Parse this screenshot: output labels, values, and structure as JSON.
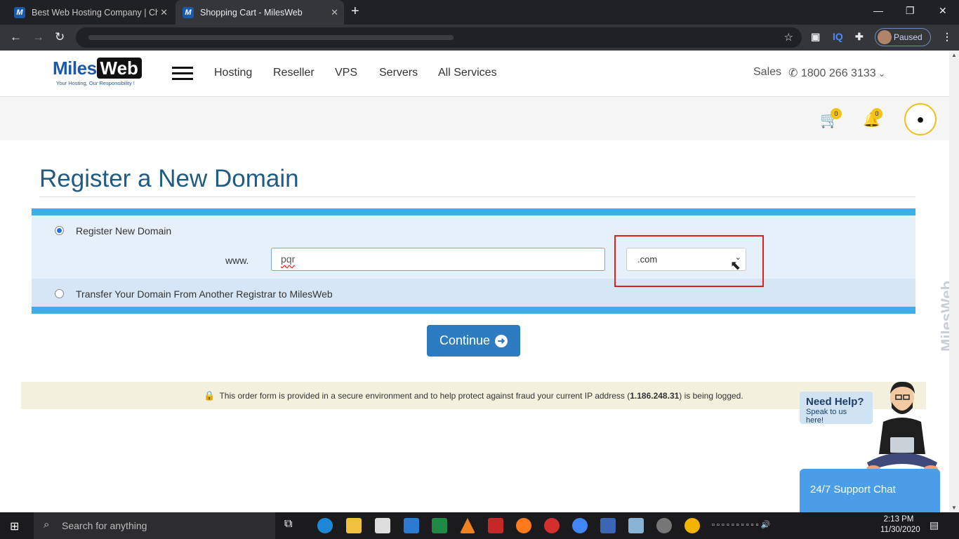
{
  "browser": {
    "tabs": [
      {
        "label": "Best Web Hosting Company | Ch",
        "favicon": "M"
      },
      {
        "label": "Shopping Cart - MilesWeb",
        "favicon": "M"
      }
    ],
    "new_tab": "+",
    "profile_status": "Paused",
    "extension_iq": "IQ"
  },
  "site": {
    "logo_miles": "Miles",
    "logo_web": "Web",
    "logo_tagline": "Your Hosting, Our Responsibility !",
    "nav": [
      "Hosting",
      "Reseller",
      "VPS",
      "Servers",
      "All Services"
    ],
    "sales_label": "Sales",
    "phone": "1800 266 3133",
    "cart_count": "0",
    "notif_count": "0"
  },
  "form": {
    "title": "Register a New Domain",
    "option_register": "Register New Domain",
    "option_transfer": "Transfer Your Domain From Another Registrar to MilesWeb",
    "www_label": "www.",
    "domain_value": "pqr",
    "tld_value": ".com",
    "continue_label": "Continue"
  },
  "secure_notice": {
    "text_before": "This order form is provided in a secure environment and to help protect against fraud your current IP address (",
    "ip": "1.186.248.31",
    "text_after": ") is being logged."
  },
  "side_logo": "MilesWeb",
  "help": {
    "title": "Need Help?",
    "subtitle": "Speak to us here!",
    "chat_label": "24/7 Support Chat"
  },
  "taskbar": {
    "search_placeholder": "Search for anything",
    "time": "2:13 PM",
    "date": "11/30/2020"
  }
}
